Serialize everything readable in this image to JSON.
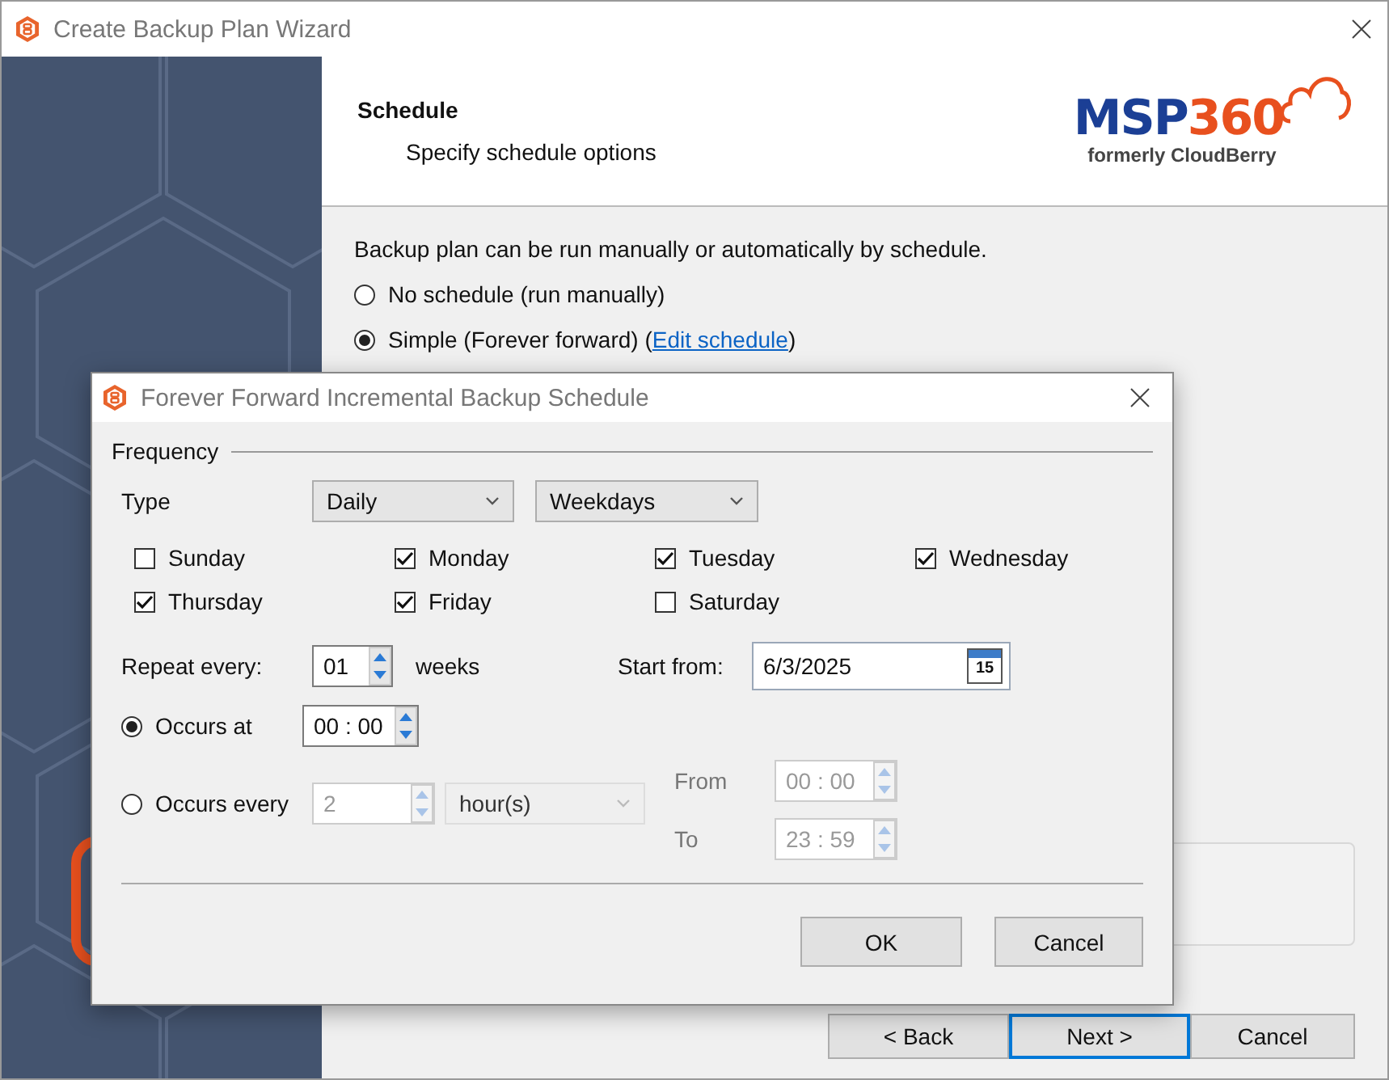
{
  "wizard": {
    "title": "Create Backup Plan Wizard",
    "heading": "Schedule",
    "subheading": "Specify schedule options",
    "logo": {
      "mark_parts": [
        "MSP",
        "360"
      ],
      "tagline": "formerly CloudBerry"
    },
    "intro": "Backup plan can be run manually or automatically by schedule.",
    "modes": [
      {
        "label": "No schedule (run manually)",
        "selected": false
      },
      {
        "label": "Simple (Forever forward) (",
        "link": "Edit schedule",
        "after": ")",
        "selected": true
      }
    ],
    "buttons": [
      {
        "label": "< Back",
        "default": false
      },
      {
        "label": "Next >",
        "default": true
      },
      {
        "label": "Cancel",
        "default": false
      }
    ]
  },
  "dialog": {
    "title": "Forever Forward Incremental Backup Schedule",
    "group": "Frequency",
    "type_label": "Type",
    "type_value": "Daily",
    "subtype_value": "Weekdays",
    "days": [
      {
        "label": "Sunday",
        "checked": false
      },
      {
        "label": "Monday",
        "checked": true
      },
      {
        "label": "Tuesday",
        "checked": true
      },
      {
        "label": "Wednesday",
        "checked": true
      },
      {
        "label": "Thursday",
        "checked": true
      },
      {
        "label": "Friday",
        "checked": true
      },
      {
        "label": "Saturday",
        "checked": false
      }
    ],
    "repeat": {
      "label": "Repeat every:",
      "value": "01",
      "unit": "weeks"
    },
    "start": {
      "label": "Start from:",
      "value": "6/3/2025",
      "calendar_day": "15"
    },
    "occurs_at": {
      "label": "Occurs at",
      "selected": true,
      "time": "00 : 00"
    },
    "occurs_every": {
      "label": "Occurs every",
      "selected": false,
      "value": "2",
      "unit": "hour(s)",
      "disabled": true
    },
    "from": {
      "label": "From",
      "time": "00 : 00",
      "disabled": true
    },
    "to": {
      "label": "To",
      "time": "23 : 59",
      "disabled": true
    },
    "buttons": [
      "OK",
      "Cancel"
    ]
  }
}
